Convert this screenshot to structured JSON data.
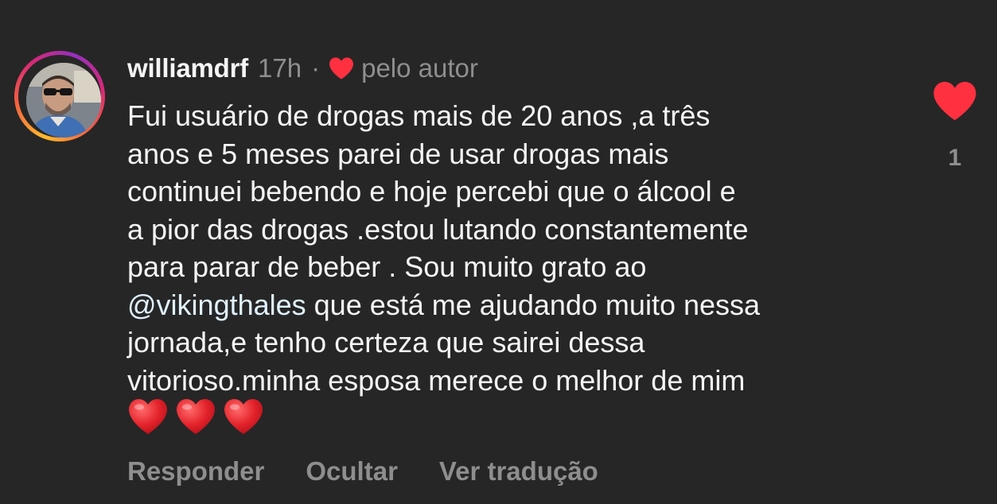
{
  "comment": {
    "username": "williamdrf",
    "time": "17h",
    "separator": "·",
    "liked_by_label": "pelo autor",
    "avatar_icon": "profile-photo",
    "body_lines": [
      "Fui usuário de drogas mais de 20 anos ,a três",
      "anos e 5 meses parei de usar drogas mais",
      "continuei bebendo e hoje percebi que o álcool e",
      "a pior das drogas .estou lutando constantemente",
      "para parar de beber . Sou muito grato ao"
    ],
    "mention": "@vikingthales",
    "mention_line_rest": " que está me ajudando muito nessa",
    "body_lines_after": [
      "jornada,e tenho certeza que sairei dessa",
      "vitorioso.minha esposa merece o melhor de mim"
    ],
    "emojis": [
      "red-heart-emoji",
      "red-heart-emoji",
      "red-heart-emoji"
    ],
    "like_count": "1",
    "like_icon": "heart-icon",
    "heart_color": "#ff3040"
  },
  "actions": {
    "reply": "Responder",
    "hide": "Ocultar",
    "translate": "Ver tradução"
  }
}
